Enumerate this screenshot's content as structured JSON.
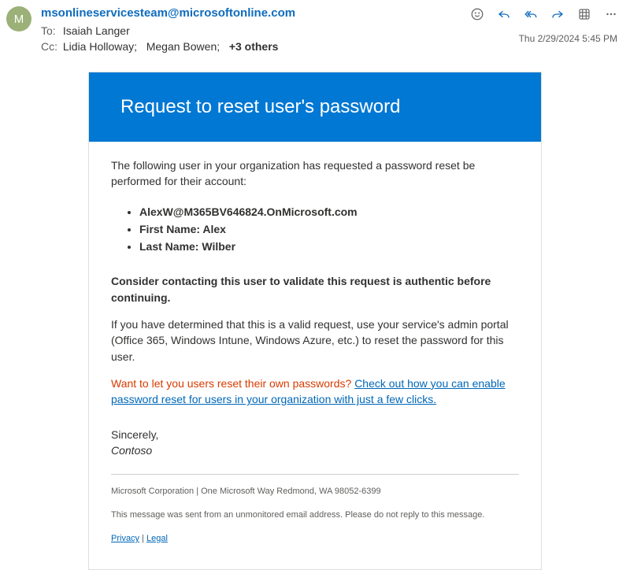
{
  "header": {
    "avatar_initial": "M",
    "from": "msonlineservicesteam@microsoftonline.com",
    "to_label": "To:",
    "to_value": "Isaiah Langer",
    "cc_label": "Cc:",
    "cc_value_1": "Lidia Holloway;",
    "cc_value_2": "Megan Bowen;",
    "cc_more": "+3 others",
    "timestamp": "Thu 2/29/2024 5:45 PM"
  },
  "body": {
    "hero_title": "Request to reset user's password",
    "intro": "The following user in your organization has requested a password reset be performed for their account:",
    "li1": "AlexW@M365BV646824.OnMicrosoft.com",
    "li2": "First Name: Alex",
    "li3": "Last Name: Wilber",
    "consider": "Consider contacting this user to validate this request is authentic before continuing.",
    "valid_req": "If you have determined that this is a valid request, use your service's admin portal (Office 365, Windows Intune, Windows Azure, etc.) to reset the password for this user.",
    "warn_prefix": "Want to let you users reset their own passwords? ",
    "warn_link": "Check out how you can enable password reset for users in your organization with just a few clicks.",
    "sincerely": "Sincerely,",
    "org": "Contoso",
    "footer_addr": "Microsoft Corporation | One Microsoft Way Redmond, WA 98052-6399",
    "footer_unmonitored": "This message was sent from an unmonitored email address. Please do not reply to this message.",
    "privacy": "Privacy",
    "pipe": " | ",
    "legal": "Legal"
  }
}
